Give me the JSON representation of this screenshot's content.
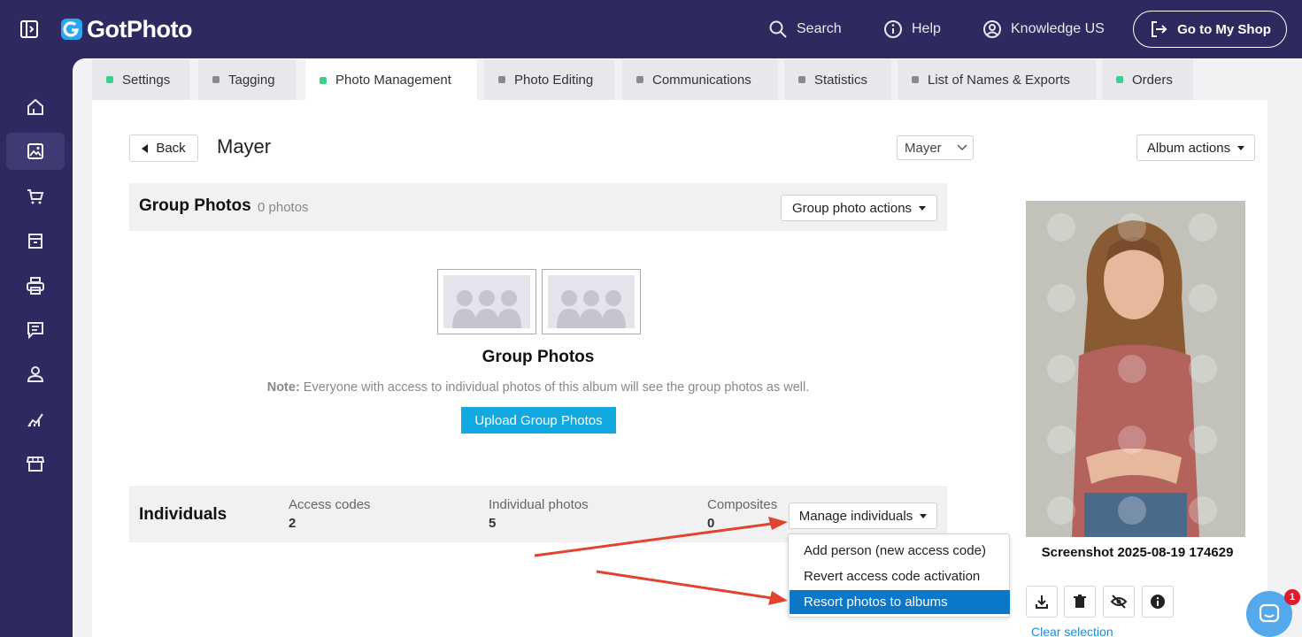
{
  "app": {
    "name": "GotPhoto"
  },
  "topnav": {
    "search": "Search",
    "help": "Help",
    "account": "Knowledge US",
    "shop_button": "Go to My Shop"
  },
  "tabs": [
    {
      "label": "Settings",
      "dot_color": "#3ccf8e"
    },
    {
      "label": "Tagging",
      "dot_color": "#8a8a8a"
    },
    {
      "label": "Photo Management",
      "dot_color": "#3ccf8e",
      "active": true
    },
    {
      "label": "Photo Editing",
      "dot_color": "#8a8a8a"
    },
    {
      "label": "Communications",
      "dot_color": "#8a8a8a"
    },
    {
      "label": "Statistics",
      "dot_color": "#8a8a8a"
    },
    {
      "label": "List of Names & Exports",
      "dot_color": "#8a8a8a"
    },
    {
      "label": "Orders",
      "dot_color": "#3ccf8e"
    }
  ],
  "header": {
    "back": "Back",
    "title": "Mayer",
    "album_select": "Mayer",
    "album_actions": "Album actions"
  },
  "group": {
    "title": "Group Photos",
    "count": "0 photos",
    "actions": "Group photo actions",
    "heading": "Group Photos",
    "note_label": "Note:",
    "note_text": " Everyone with access to individual photos of this album will see the group photos as well.",
    "upload": "Upload Group Photos"
  },
  "individuals": {
    "title": "Individuals",
    "stats": [
      {
        "label": "Access codes",
        "value": "2"
      },
      {
        "label": "Individual photos",
        "value": "5"
      },
      {
        "label": "Composites",
        "value": "0"
      }
    ],
    "manage": "Manage individuals",
    "menu": [
      "Add person (new access code)",
      "Revert access code activation",
      "Resort photos to albums"
    ]
  },
  "preview": {
    "filename": "Screenshot 2025-08-19 174629",
    "clear_selection": "Clear selection"
  },
  "chat": {
    "badge": "1"
  },
  "colors": {
    "nav_bg": "#2e2a5f",
    "accent_blue": "#12a8e0",
    "menu_highlight": "#0a77c8",
    "annotation_arrow": "#e0432e"
  }
}
